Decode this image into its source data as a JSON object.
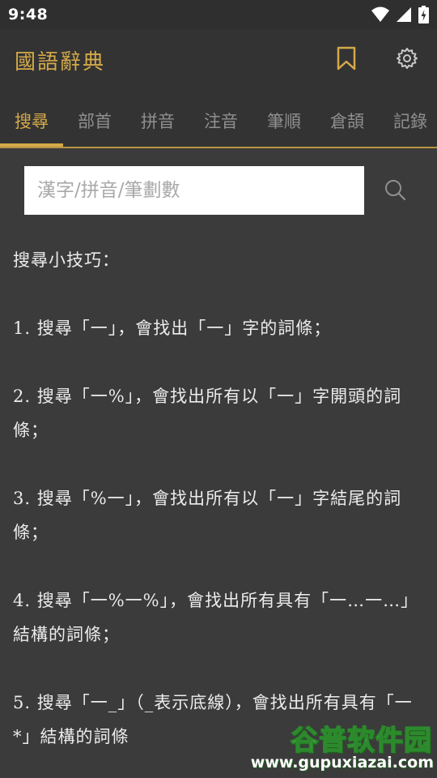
{
  "status_bar": {
    "time": "9:48",
    "icons": [
      "wifi-icon",
      "cellular-signal-icon",
      "battery-charging-icon"
    ]
  },
  "app_bar": {
    "title": "國語辭典",
    "actions": [
      "bookmark-icon",
      "settings-gear-icon"
    ]
  },
  "tabs": [
    {
      "label": "搜尋",
      "active": true
    },
    {
      "label": "部首",
      "active": false
    },
    {
      "label": "拼音",
      "active": false
    },
    {
      "label": "注音",
      "active": false
    },
    {
      "label": "筆順",
      "active": false
    },
    {
      "label": "倉頡",
      "active": false
    },
    {
      "label": "記錄",
      "active": false
    }
  ],
  "search": {
    "placeholder": "漢字/拼音/筆劃數",
    "value": ""
  },
  "tips": {
    "heading": "搜尋小技巧：",
    "items": [
      " 1. 搜尋「一」，會找出「一」字的詞條；",
      " 2. 搜尋「一%」，會找出所有以「一」字開頭的詞條；",
      " 3. 搜尋「%一」，會找出所有以「一」字結尾的詞條；",
      " 4. 搜尋「一%一%」，會找出所有具有「一…一…」結構的詞條；",
      " 5. 搜尋「一_」（_表示底線），會找出所有具有「一*」結構的詞條"
    ]
  },
  "watermark": {
    "brand": "谷普软件园",
    "url": "www.gupuxiazai.com"
  },
  "colors": {
    "background": "#3b3b3b",
    "app_bar": "#333333",
    "accent_gold": "#d4a94a",
    "tab_inactive": "#8f8f8f",
    "text": "#ececec"
  }
}
